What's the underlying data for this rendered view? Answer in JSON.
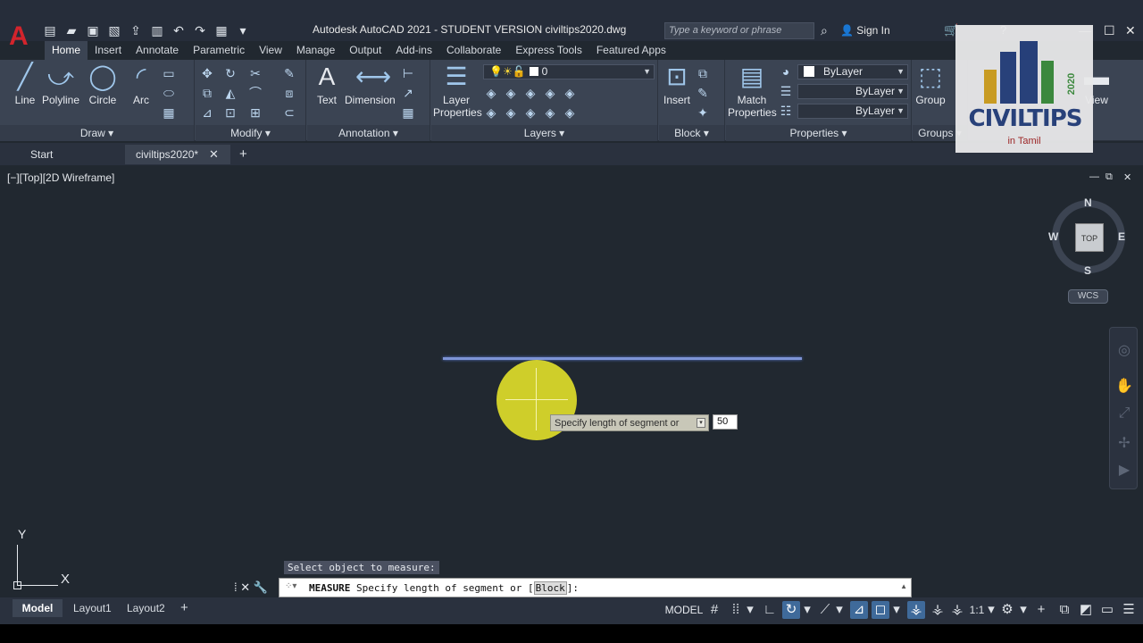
{
  "app": {
    "logo": "A",
    "window_title": "Autodesk AutoCAD 2021 - STUDENT VERSION    civiltips2020.dwg",
    "search_placeholder": "Type a keyword or phrase",
    "sign_in": "Sign In"
  },
  "ribbon_tabs": [
    "Home",
    "Insert",
    "Annotate",
    "Parametric",
    "View",
    "Manage",
    "Output",
    "Add-ins",
    "Collaborate",
    "Express Tools",
    "Featured Apps"
  ],
  "panels": {
    "draw": {
      "title": "Draw",
      "line": "Line",
      "polyline": "Polyline",
      "circle": "Circle",
      "arc": "Arc"
    },
    "modify": {
      "title": "Modify"
    },
    "annotation": {
      "title": "Annotation",
      "text": "Text",
      "dimension": "Dimension"
    },
    "layers": {
      "title": "Layers",
      "layer_properties_1": "Layer",
      "layer_properties_2": "Properties",
      "current_layer": "0"
    },
    "block": {
      "title": "Block",
      "insert": "Insert"
    },
    "properties": {
      "title": "Properties",
      "match_1": "Match",
      "match_2": "Properties",
      "color": "ByLayer",
      "linetype": "ByLayer",
      "lineweight": "ByLayer"
    },
    "groups": {
      "title": "Groups",
      "group": "Group"
    },
    "extra": {
      "view": "View"
    }
  },
  "file_tabs": {
    "start": "Start",
    "file": "civiltips2020*"
  },
  "viewport": {
    "label": "[−][Top][2D Wireframe]",
    "compass_n": "N",
    "compass_s": "S",
    "compass_e": "E",
    "compass_w": "W",
    "cube_face": "TOP",
    "wcs": "WCS"
  },
  "prompt": {
    "tooltip": "Specify length of segment or",
    "input_value": "50",
    "history": "Select object to measure:"
  },
  "command": {
    "name": "MEASURE",
    "text": " Specify length of segment or [",
    "option": "Block",
    "suffix": "]:"
  },
  "ucs": {
    "x": "X",
    "y": "Y"
  },
  "layout_tabs": {
    "model": "Model",
    "layout1": "Layout1",
    "layout2": "Layout2"
  },
  "status": {
    "model": "MODEL",
    "scale": "1:1"
  },
  "watermark": {
    "title": "CIVILTIPS",
    "subtitle": "in Tamil",
    "year": "2020"
  }
}
